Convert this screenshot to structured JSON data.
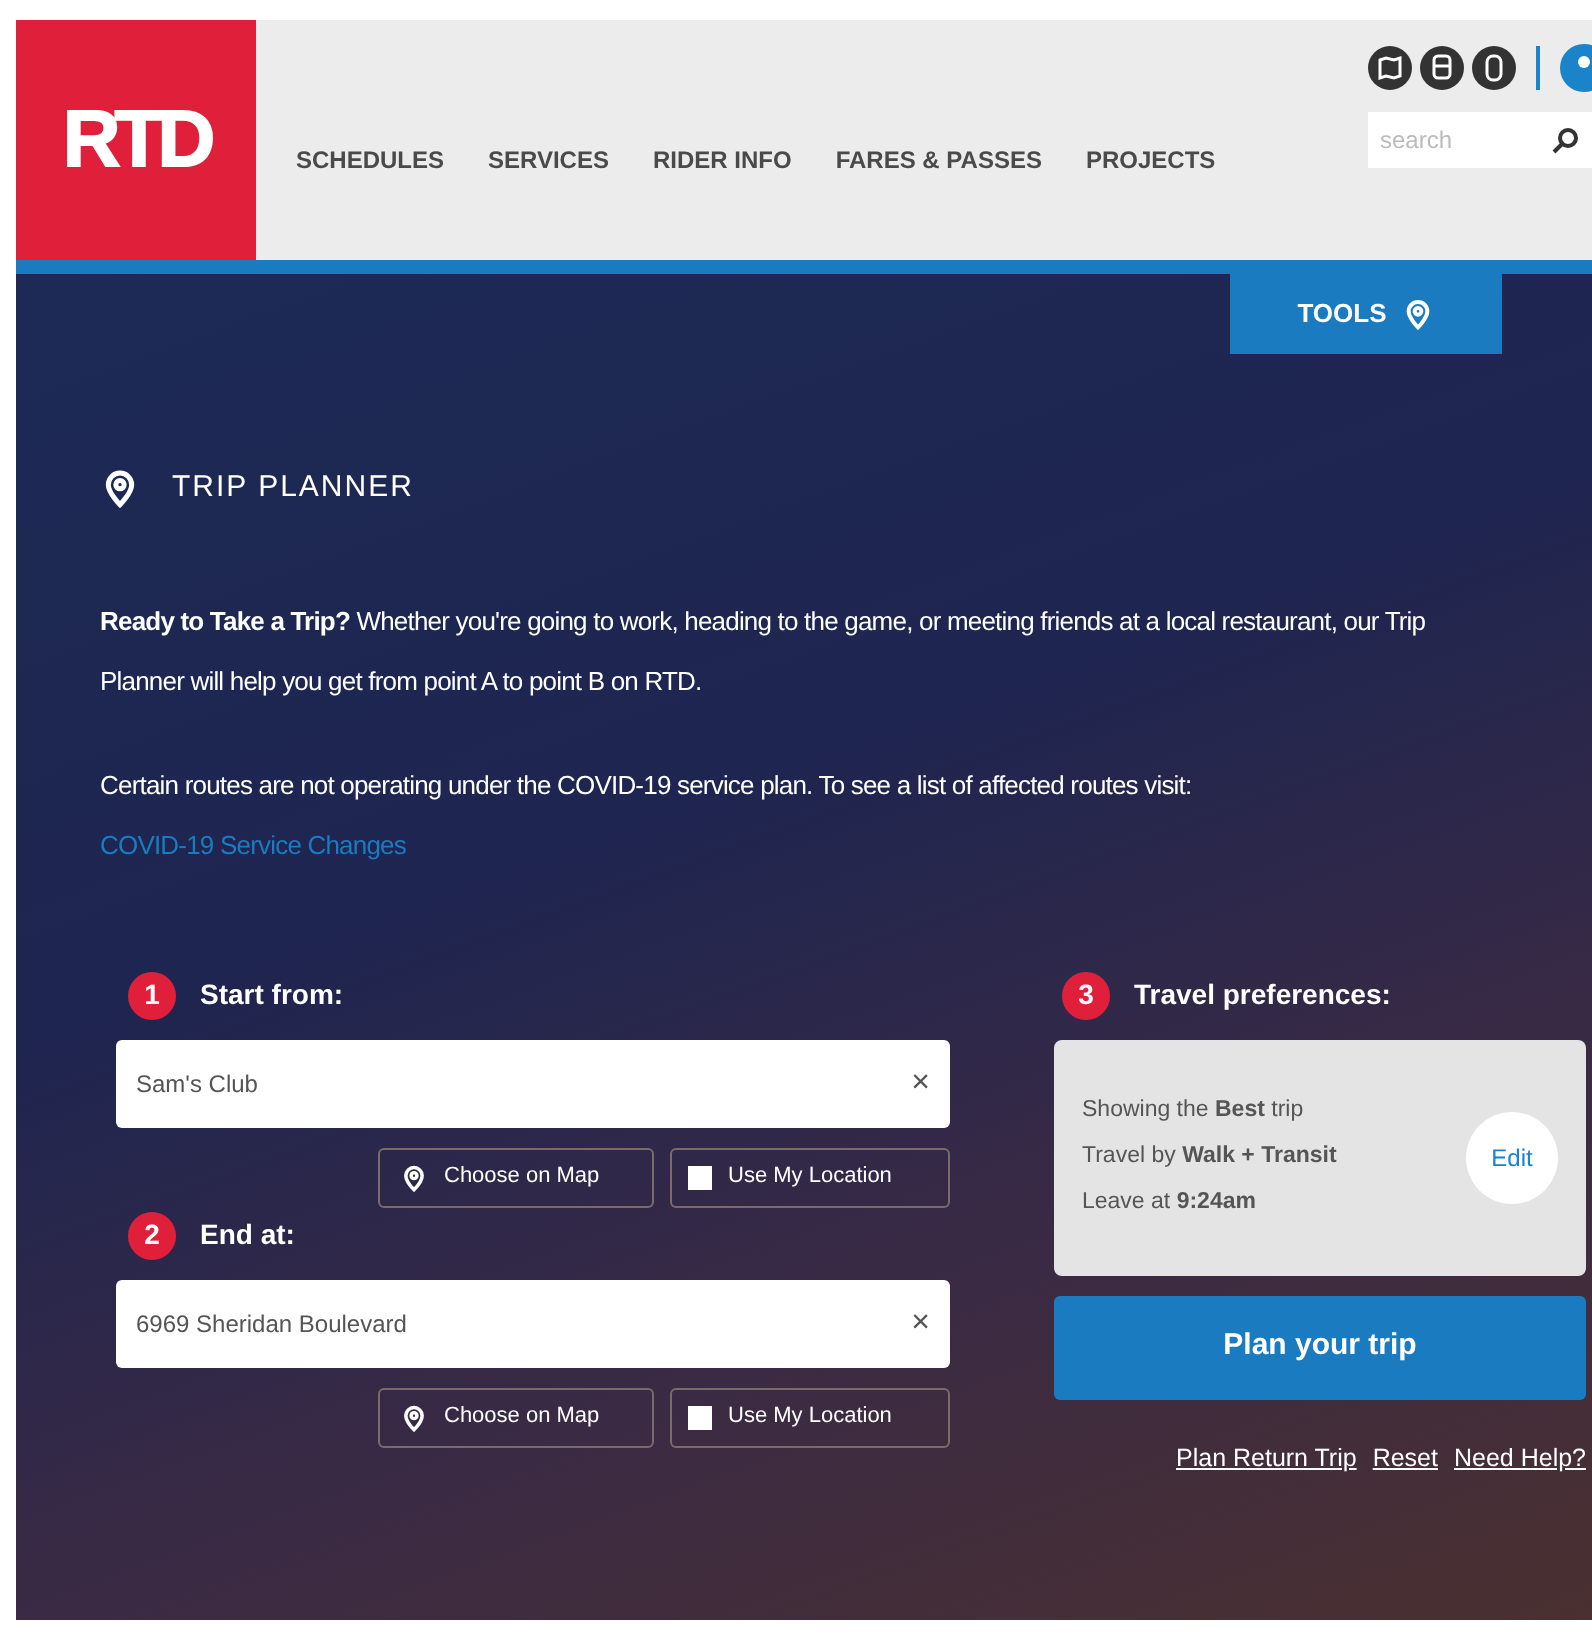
{
  "header": {
    "logo": "RTD",
    "nav": [
      "SCHEDULES",
      "SERVICES",
      "RIDER INFO",
      "FARES & PASSES",
      "PROJECTS"
    ],
    "search": {
      "placeholder": "search"
    }
  },
  "tools_tab": "TOOLS",
  "title": "TRIP PLANNER",
  "intro": "**Ready to Take a Trip?** Whether you're going to work, heading to the game, or meeting friends at a local restaurant, our Trip Planner will help you get from point A to point B on RTD.",
  "notice": {
    "text": "Certain routes are not operating under the COVID-19 service plan. To see a list of affected routes visit:",
    "link": "COVID-19 Service Changes"
  },
  "steps": [
    {
      "number": "1",
      "label": "Start from:",
      "value": "Sam's Club",
      "clear": "×",
      "map_button": "Choose on Map",
      "location": {
        "label": "Use My Location",
        "checked": false
      }
    },
    {
      "number": "2",
      "label": "End at:",
      "value": "6969 Sheridan Boulevard",
      "clear": "×",
      "map_button": "Choose on Map",
      "location": {
        "label": "Use My Location",
        "checked": false
      }
    }
  ],
  "preferences": {
    "number": "3",
    "label": "Travel preferences:",
    "lines": [
      "Showing the **Best** trip",
      "Travel by **Walk + Transit**",
      "Leave at **9:24am**"
    ],
    "edit": "Edit"
  },
  "plan_button": "Plan your trip",
  "links": [
    "Plan Return Trip",
    "Reset",
    "Need Help?"
  ]
}
